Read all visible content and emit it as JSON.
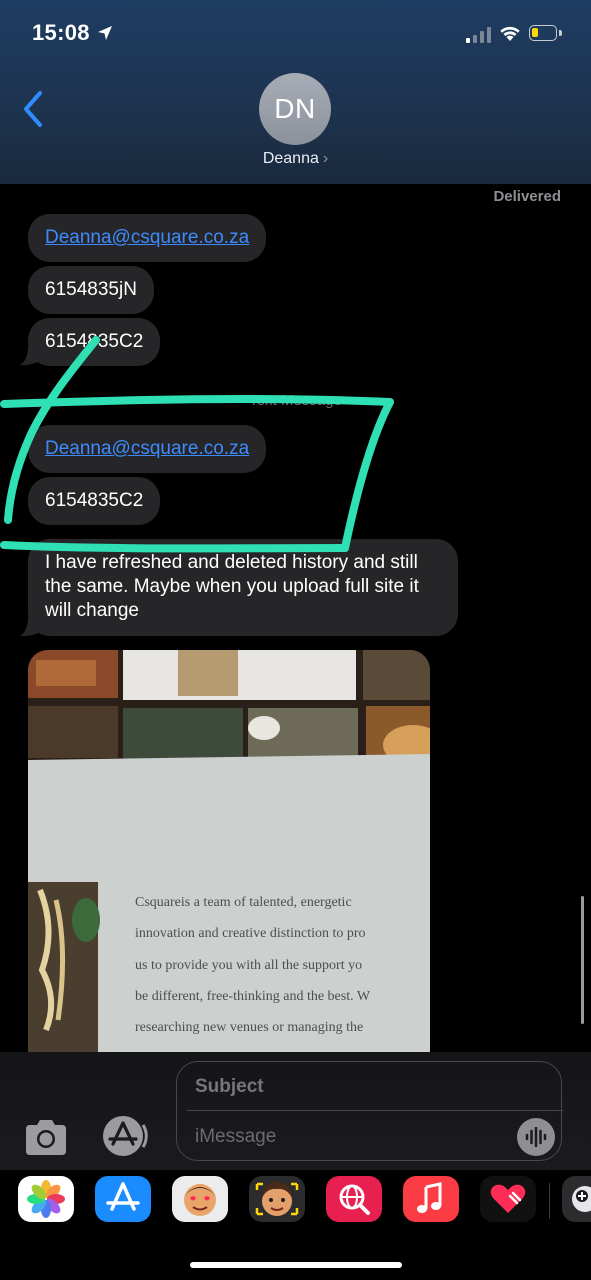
{
  "status_bar": {
    "time": "15:08",
    "battery_level": 0.3
  },
  "header": {
    "avatar_initials": "DN",
    "contact_name": "Deanna",
    "name_chevron": "›"
  },
  "conversation": {
    "delivered": "Delivered",
    "group1": [
      {
        "text": "Deanna@csquare.co.za",
        "is_link": true
      },
      {
        "text": "6154835jN",
        "is_link": false
      },
      {
        "text": "6154835C2",
        "is_link": false
      }
    ],
    "separator": "Text Message",
    "group2": [
      {
        "text": "Deanna@csquare.co.za",
        "is_link": true
      },
      {
        "text": "6154835C2",
        "is_link": false
      }
    ],
    "long_message": "I have refreshed and deleted history and still the same. Maybe when you upload full site it will change",
    "photo_lines": [
      "Csquareis a team of talented, energetic",
      "innovation and creative distinction to pro",
      "us to provide you with all the support yo",
      "be different, free-thinking and the best. W",
      "researching new venues or managing the"
    ]
  },
  "composer": {
    "subject_placeholder": "Subject",
    "message_placeholder": "iMessage"
  },
  "app_drawer": [
    {
      "name": "photos-app-icon"
    },
    {
      "name": "app-store-icon"
    },
    {
      "name": "memoji-stickers-icon"
    },
    {
      "name": "animoji-icon"
    },
    {
      "name": "web-search-icon"
    },
    {
      "name": "music-app-icon"
    },
    {
      "name": "digital-touch-icon"
    },
    {
      "name": "more-apps-icon"
    }
  ],
  "colors": {
    "link": "#3d8bff",
    "bubble": "#262628",
    "annotation": "#2ee0b4",
    "header": "#1e3656"
  }
}
